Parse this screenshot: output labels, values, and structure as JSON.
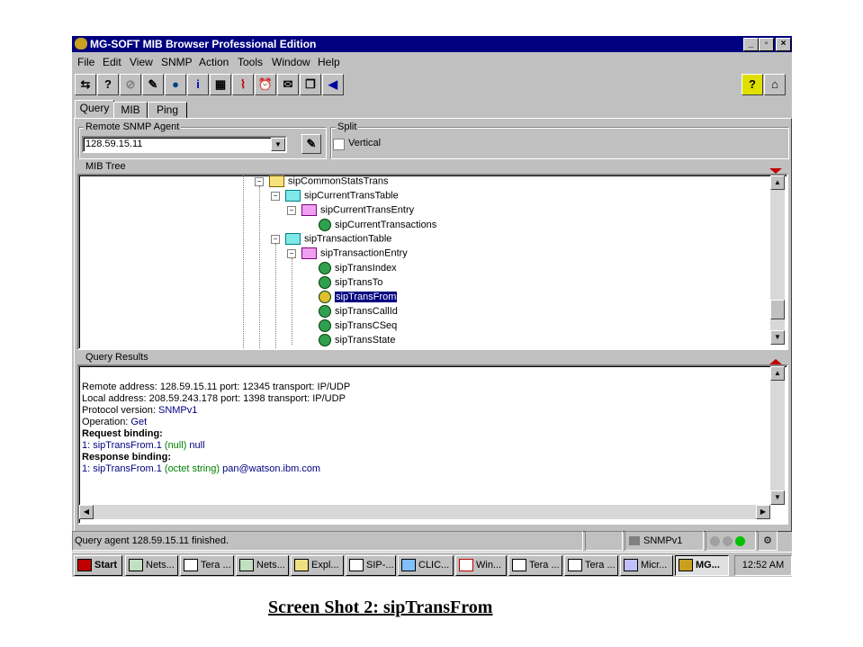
{
  "window": {
    "title": "MG-SOFT MIB Browser Professional Edition",
    "caption_buttons": {
      "minimize": "_",
      "maximize": "▫",
      "close": "×"
    }
  },
  "menu": [
    {
      "label": "File"
    },
    {
      "label": "Edit"
    },
    {
      "label": "View"
    },
    {
      "label": "SNMP"
    },
    {
      "label": "Action"
    },
    {
      "label": "Tools"
    },
    {
      "label": "Window"
    },
    {
      "label": "Help"
    }
  ],
  "tabs": [
    {
      "label": "Query",
      "active": true
    },
    {
      "label": "MIB"
    },
    {
      "label": "Ping"
    }
  ],
  "remote_agent": {
    "label": "Remote SNMP Agent",
    "value": "128.59.15.11"
  },
  "split": {
    "label": "Split",
    "checkbox_label": "Vertical",
    "checked": false
  },
  "mib_tree": {
    "label": "MIB Tree",
    "nodes": [
      {
        "label": "sipCommonStatsTrans",
        "type": "folder-y",
        "level": 0,
        "expander": "−"
      },
      {
        "label": "sipCurrentTransTable",
        "type": "folder-c",
        "level": 1,
        "expander": "−"
      },
      {
        "label": "sipCurrentTransEntry",
        "type": "folder-m",
        "level": 2,
        "expander": "−"
      },
      {
        "label": "sipCurrentTransactions",
        "type": "leaf",
        "level": 3
      },
      {
        "label": "sipTransactionTable",
        "type": "folder-c",
        "level": 1,
        "expander": "−"
      },
      {
        "label": "sipTransactionEntry",
        "type": "folder-m",
        "level": 2,
        "expander": "−"
      },
      {
        "label": "sipTransIndex",
        "type": "leaf",
        "level": 3
      },
      {
        "label": "sipTransTo",
        "type": "leaf",
        "level": 3
      },
      {
        "label": "sipTransFrom",
        "type": "leaf",
        "level": 3,
        "selected": true
      },
      {
        "label": "sipTransCallId",
        "type": "leaf",
        "level": 3
      },
      {
        "label": "sipTransCSeq",
        "type": "leaf",
        "level": 3
      },
      {
        "label": "sipTransState",
        "type": "leaf",
        "level": 3
      }
    ]
  },
  "query_results": {
    "label": "Query Results",
    "remote_address": "Remote address: 128.59.15.11  port: 12345 transport: IP/UDP",
    "local_address": "Local address: 208.59.243.178  port: 1398 transport: IP/UDP",
    "protocol_prefix": "Protocol version: ",
    "protocol_value": "SNMPv1",
    "operation_prefix": "Operation: ",
    "operation_value": "Get",
    "request_heading": "Request binding:",
    "request_prefix": "1: sipTransFrom.1 ",
    "request_type": "(null)",
    "request_value": " null",
    "response_heading": "Response binding:",
    "response_prefix": "1: sipTransFrom.1 ",
    "response_type": "(octet string)",
    "response_value": " pan@watson.ibm.com"
  },
  "status": {
    "message": "Query agent 128.59.15.11 finished.",
    "protocol": "SNMPv1"
  },
  "taskbar": {
    "start": "Start",
    "items": [
      "Nets...",
      "Tera ...",
      "Nets...",
      "Expl...",
      "SIP-...",
      "CLIC...",
      "Win...",
      "Tera ...",
      "Tera ...",
      "Micr...",
      "MG..."
    ],
    "clock": "12:52 AM"
  },
  "caption": "Screen Shot 2: sipTransFrom",
  "colors": {
    "titlebar": "#000080",
    "selection": "#000080",
    "face": "#c0c0c0"
  }
}
